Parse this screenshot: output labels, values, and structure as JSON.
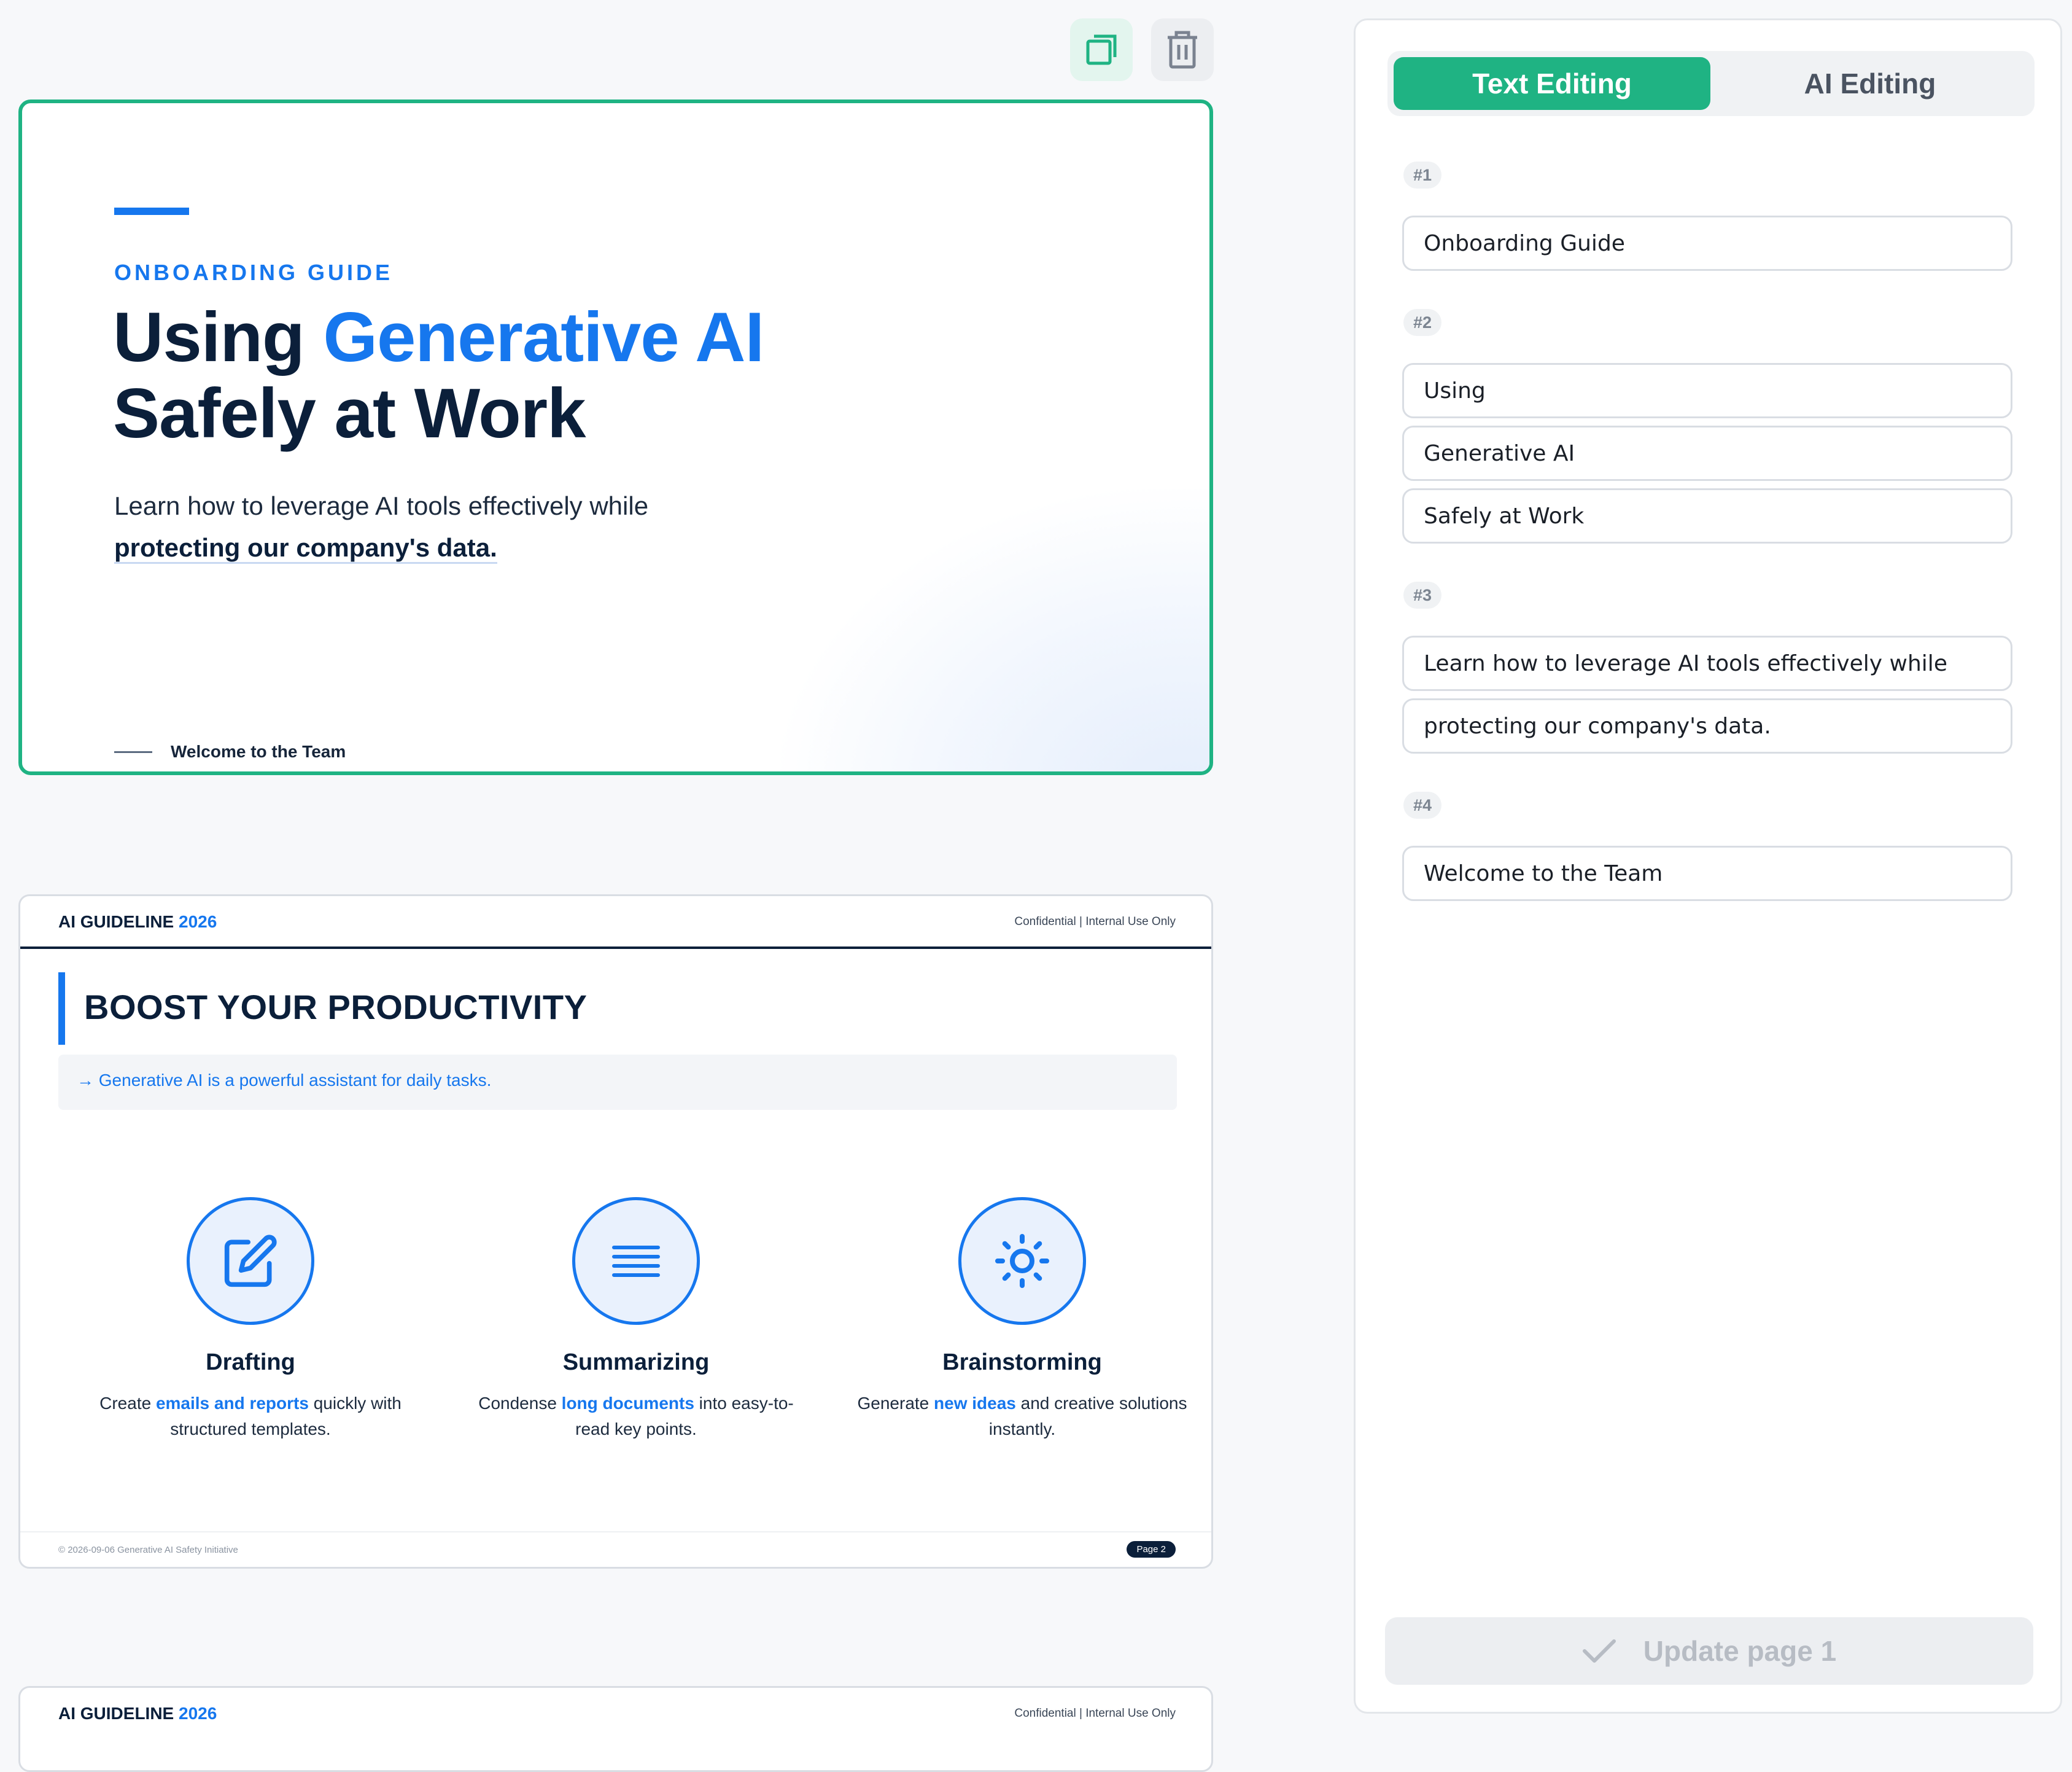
{
  "toolbar": {
    "copy_icon": "copy-icon",
    "trash_icon": "trash-icon"
  },
  "slide1": {
    "kicker": "ONBOARDING GUIDE",
    "title_part1": "Using ",
    "title_highlight": "Generative AI",
    "title_line2": "Safely at Work",
    "sub_line1": "Learn how to leverage AI tools effectively while",
    "sub_line2": "protecting our company's data.",
    "footer": "Welcome to the Team"
  },
  "slide2": {
    "brand": "AI GUIDELINE",
    "brand_year": "2026",
    "confidential": "Confidential | Internal Use Only",
    "title": "BOOST YOUR PRODUCTIVITY",
    "callout": "→ Generative AI is a powerful assistant for daily tasks.",
    "columns": [
      {
        "icon": "edit-icon",
        "label": "Drafting",
        "pre": "Create ",
        "key": "emails and reports",
        "post": " quickly with structured templates."
      },
      {
        "icon": "lines-icon",
        "label": "Summarizing",
        "pre": "Condense ",
        "key": "long documents",
        "post": " into easy-to-read key points."
      },
      {
        "icon": "sun-icon",
        "label": "Brainstorming",
        "pre": "Generate ",
        "key": "new ideas",
        "post": " and creative solutions instantly."
      }
    ],
    "copyright": "© 2026-09-06 Generative AI Safety Initiative",
    "page": "Page 2"
  },
  "slide3": {
    "brand": "AI GUIDELINE",
    "brand_year": "2026",
    "confidential": "Confidential | Internal Use Only"
  },
  "panel": {
    "tabs": [
      "Text Editing",
      "AI Editing"
    ],
    "groups": [
      {
        "badge": "#1",
        "fields": [
          "Onboarding Guide"
        ]
      },
      {
        "badge": "#2",
        "fields": [
          "Using",
          "Generative AI",
          "Safely at Work"
        ]
      },
      {
        "badge": "#3",
        "fields": [
          "Learn how to leverage AI tools effectively while",
          "protecting our company's data."
        ]
      },
      {
        "badge": "#4",
        "fields": [
          "Welcome to the Team"
        ]
      }
    ],
    "update_label": "Update page 1"
  },
  "colors": {
    "accent": "#1677ee",
    "green": "#1fb383",
    "navy": "#0b1f3a"
  }
}
